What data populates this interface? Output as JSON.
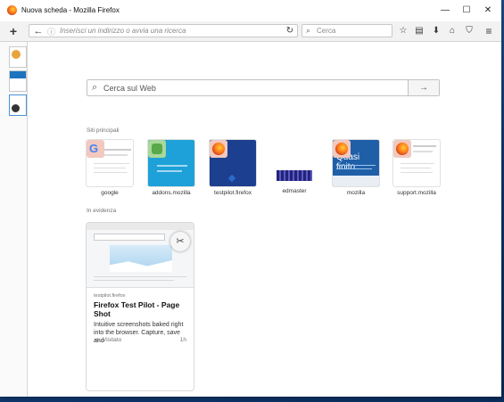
{
  "window": {
    "title": "Nuova scheda - Mozilla Firefox",
    "minimize": "—",
    "maximize": "☐",
    "close": "✕"
  },
  "toolbar": {
    "url_placeholder": "Inserisci un indirizzo o avvia una ricerca",
    "search_placeholder": "Cerca"
  },
  "newtab": {
    "search_placeholder": "Cerca sul Web",
    "top_sites_title": "Siti principali",
    "top_sites": [
      {
        "label": "google"
      },
      {
        "label": "addons.mozilla"
      },
      {
        "label": "testpilot.firefox"
      },
      {
        "label": "edmaster"
      },
      {
        "label": "mozilla"
      },
      {
        "label": "support.mozilla"
      }
    ],
    "highlights_title": "In evidenza",
    "highlight": {
      "source": "testpilot.firefox",
      "title": "Firefox Test Pilot - Page Shot",
      "description": "Intuitive screenshots baked right into the browser. Capture, save and",
      "status": "Visitato",
      "age": "1h"
    },
    "mozilla_tile_text": "Quasi finito."
  }
}
